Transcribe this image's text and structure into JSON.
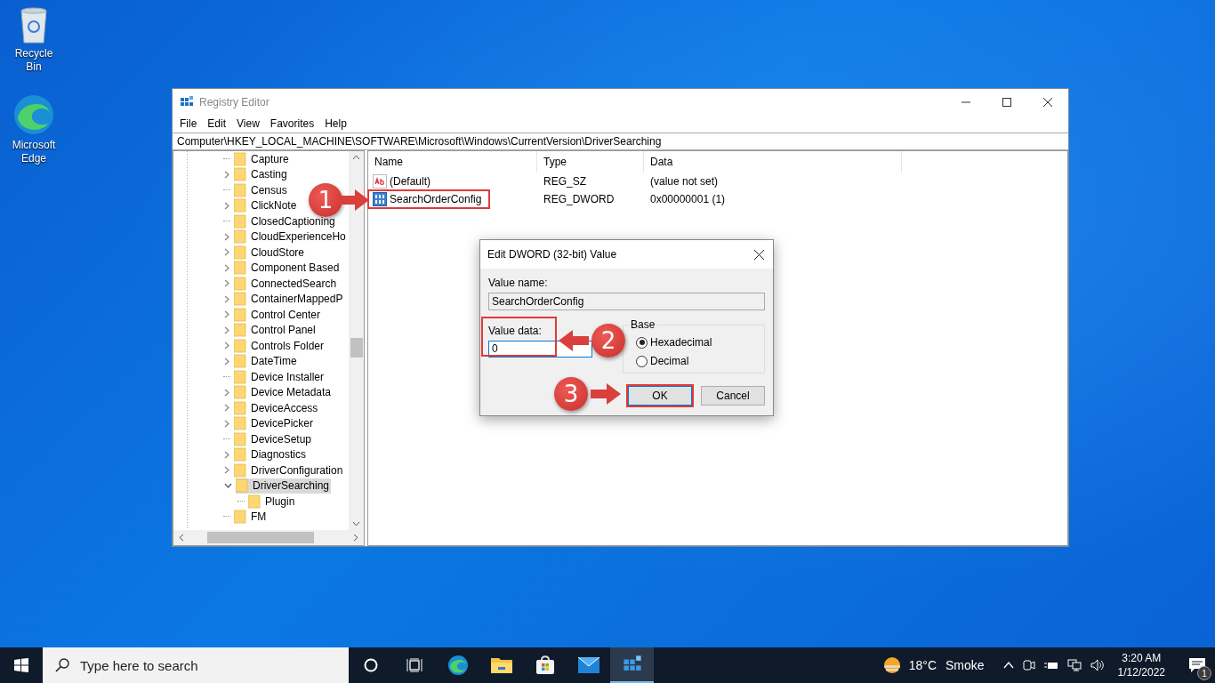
{
  "desktop_icons": [
    {
      "kind": "recycle",
      "label": "Recycle Bin"
    },
    {
      "kind": "edge",
      "label": "Microsoft Edge"
    }
  ],
  "window": {
    "title": "Registry Editor",
    "menu": [
      "File",
      "Edit",
      "View",
      "Favorites",
      "Help"
    ],
    "address": "Computer\\HKEY_LOCAL_MACHINE\\SOFTWARE\\Microsoft\\Windows\\CurrentVersion\\DriverSearching"
  },
  "tree": [
    {
      "label": "Capture",
      "expandable": false,
      "selected": false
    },
    {
      "label": "Casting",
      "expandable": true,
      "expanded": false,
      "selected": false
    },
    {
      "label": "Census",
      "expandable": false,
      "selected": false
    },
    {
      "label": "ClickNote",
      "expandable": true,
      "expanded": false,
      "selected": false
    },
    {
      "label": "ClosedCaptioning",
      "expandable": false,
      "selected": false
    },
    {
      "label": "CloudExperienceHo",
      "expandable": true,
      "expanded": false,
      "selected": false
    },
    {
      "label": "CloudStore",
      "expandable": true,
      "expanded": false,
      "selected": false
    },
    {
      "label": "Component Based",
      "expandable": true,
      "expanded": false,
      "selected": false
    },
    {
      "label": "ConnectedSearch",
      "expandable": true,
      "expanded": false,
      "selected": false
    },
    {
      "label": "ContainerMappedP",
      "expandable": true,
      "expanded": false,
      "selected": false
    },
    {
      "label": "Control Center",
      "expandable": true,
      "expanded": false,
      "selected": false
    },
    {
      "label": "Control Panel",
      "expandable": true,
      "expanded": false,
      "selected": false
    },
    {
      "label": "Controls Folder",
      "expandable": true,
      "expanded": false,
      "selected": false
    },
    {
      "label": "DateTime",
      "expandable": true,
      "expanded": false,
      "selected": false
    },
    {
      "label": "Device Installer",
      "expandable": false,
      "selected": false
    },
    {
      "label": "Device Metadata",
      "expandable": true,
      "expanded": false,
      "selected": false
    },
    {
      "label": "DeviceAccess",
      "expandable": true,
      "expanded": false,
      "selected": false
    },
    {
      "label": "DevicePicker",
      "expandable": true,
      "expanded": false,
      "selected": false
    },
    {
      "label": "DeviceSetup",
      "expandable": false,
      "selected": false
    },
    {
      "label": "Diagnostics",
      "expandable": true,
      "expanded": false,
      "selected": false
    },
    {
      "label": "DriverConfiguration",
      "expandable": true,
      "expanded": false,
      "selected": false
    },
    {
      "label": "DriverSearching",
      "expandable": true,
      "expanded": true,
      "selected": true,
      "children": [
        {
          "label": "Plugin",
          "expandable": false,
          "selected": false
        }
      ]
    },
    {
      "label": "FM",
      "expandable": false,
      "selected": false
    }
  ],
  "values": {
    "columns": [
      "Name",
      "Type",
      "Data"
    ],
    "rows": [
      {
        "kind": "string",
        "name": "(Default)",
        "type": "REG_SZ",
        "data": "(value not set)",
        "highlighted": false
      },
      {
        "kind": "binary",
        "name": "SearchOrderConfig",
        "type": "REG_DWORD",
        "data": "0x00000001 (1)",
        "highlighted": true
      }
    ]
  },
  "dialog": {
    "title": "Edit DWORD (32-bit) Value",
    "value_name_label": "Value name:",
    "value_name": "SearchOrderConfig",
    "value_data_label": "Value data:",
    "value_data": "0",
    "value_data_highlighted": true,
    "base_label": "Base",
    "bases": [
      {
        "label": "Hexadecimal",
        "selected": true
      },
      {
        "label": "Decimal",
        "selected": false
      }
    ],
    "buttons": [
      {
        "label": "OK",
        "highlighted": true
      },
      {
        "label": "Cancel",
        "highlighted": false
      }
    ]
  },
  "annotations": [
    "1",
    "2",
    "3"
  ],
  "taskbar": {
    "search_placeholder": "Type here to search",
    "apps": [
      {
        "kind": "cortana",
        "active": false
      },
      {
        "kind": "taskview",
        "active": false
      },
      {
        "kind": "edge",
        "active": false
      },
      {
        "kind": "explorer",
        "active": false
      },
      {
        "kind": "store",
        "active": false
      },
      {
        "kind": "mail",
        "active": false
      },
      {
        "kind": "regedit",
        "active": true
      }
    ],
    "temperature": "18°C",
    "weather": "Smoke",
    "time": "3:20 AM",
    "date": "1/12/2022",
    "notifications": "1"
  }
}
